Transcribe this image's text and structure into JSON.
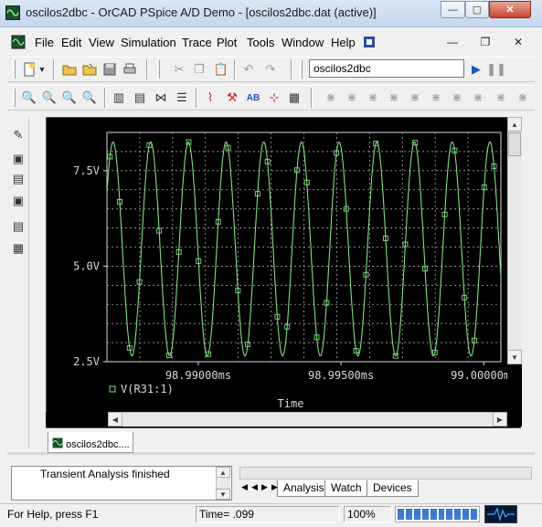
{
  "window": {
    "title": "oscilos2dbc - OrCAD PSpice A/D Demo - [oscilos2dbc.dat (active)]",
    "buttons": {
      "minimize": "—",
      "maximize": "▢",
      "close": "✕"
    }
  },
  "menubar": {
    "items": [
      "File",
      "Edit",
      "View",
      "Simulation",
      "Trace",
      "Plot",
      "Tools",
      "Window",
      "Help"
    ],
    "mdi": {
      "minimize": "—",
      "restore": "❐",
      "close": "✕"
    }
  },
  "toolbar": {
    "profile": "oscilos2dbc",
    "icons": [
      "new-icon",
      "open-icon",
      "save-icon",
      "print-icon",
      "cut-icon",
      "copy-icon",
      "paste-icon",
      "undo-icon",
      "redo-icon",
      "run-icon",
      "pause-icon"
    ]
  },
  "plot": {
    "background": "#000000",
    "trace_color": "#7fe07f",
    "axis_color": "#d8d8d8",
    "trace_label": "V(R31:1)",
    "xlabel": "Time"
  },
  "chart_data": {
    "type": "line",
    "title": "",
    "xlabel": "Time",
    "ylabel": "",
    "x_ticks": [
      "98.99000ms",
      "98.99500ms",
      "99.00000ms"
    ],
    "y_ticks": [
      "7.5V",
      "5.0V",
      "2.5V"
    ],
    "xlim": [
      98.9868,
      99.0006
    ],
    "ylim": [
      2.5,
      8.5
    ],
    "grid": true,
    "legend": "bottom-left",
    "series": [
      {
        "name": "V(R31:1)",
        "waveform": "sine",
        "amplitude": 2.8,
        "offset": 5.45,
        "period_ms": 0.00132,
        "color": "#7fe07f",
        "marker": "square"
      }
    ]
  },
  "tabs": {
    "document": "oscilos2dbc....",
    "right": [
      "Analysis",
      "Watch",
      "Devices"
    ]
  },
  "output": {
    "message": "Transient Analysis finished"
  },
  "status": {
    "help": "For Help, press F1",
    "time": "Time= .099",
    "zoom": "100%",
    "progress": 1.0
  }
}
